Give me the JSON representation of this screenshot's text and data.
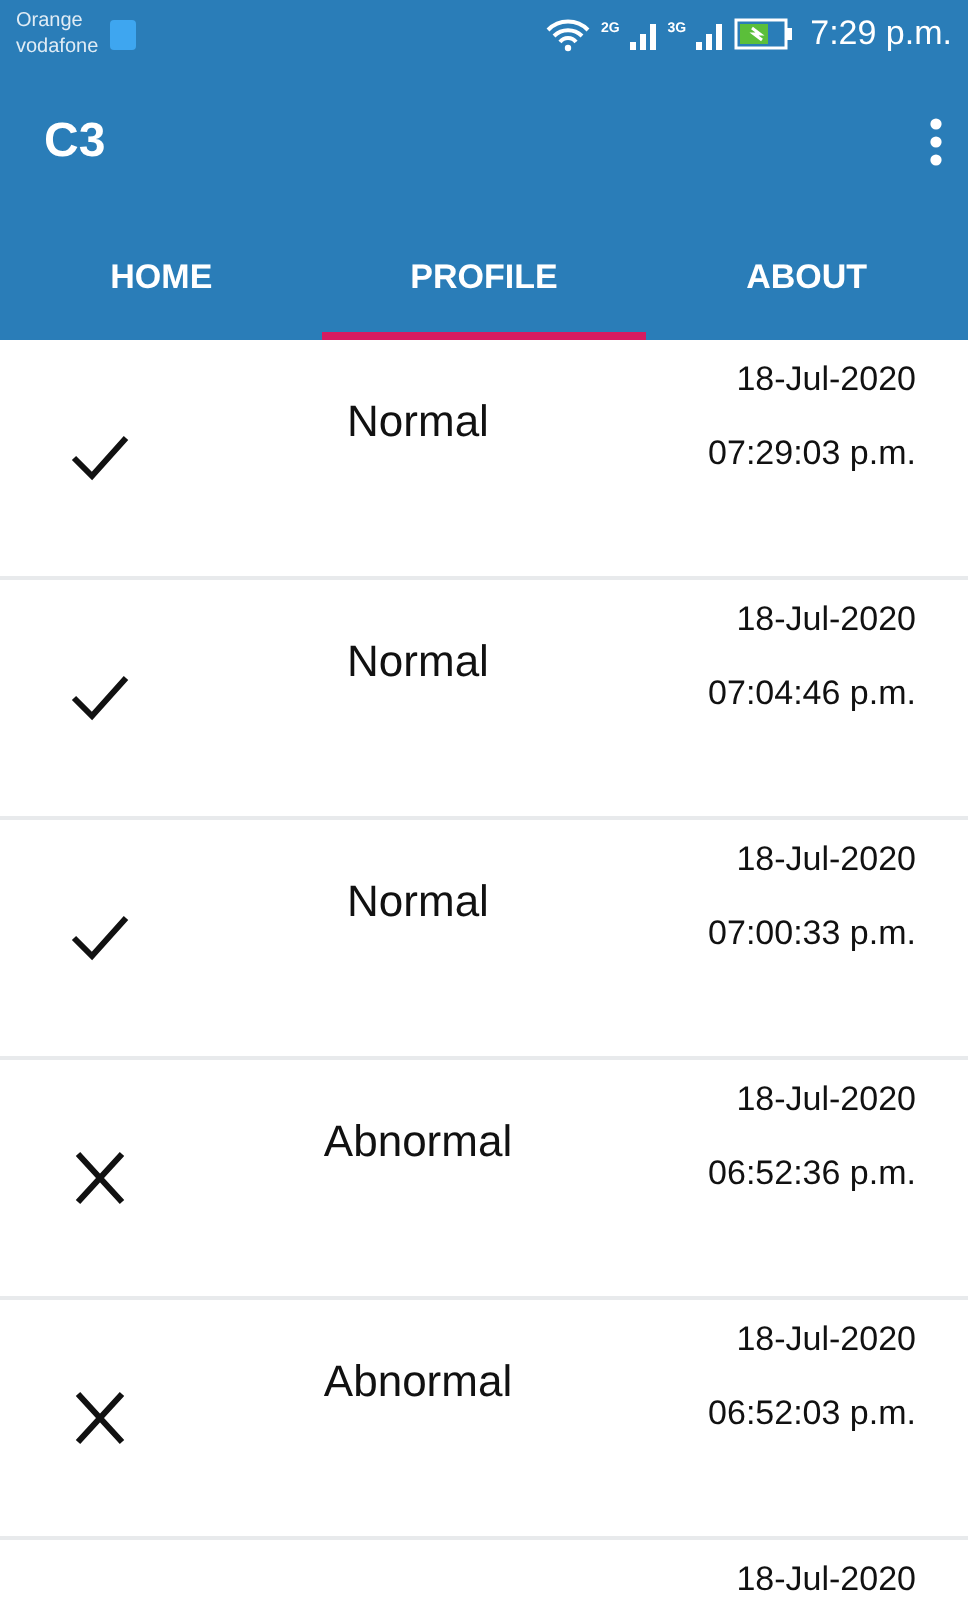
{
  "status_bar": {
    "carriers": [
      "Orange",
      "vodafone"
    ],
    "networks": [
      "2G",
      "3G"
    ],
    "time": "7:29 p.m."
  },
  "app_bar": {
    "title": "C3"
  },
  "tabs": [
    {
      "label": "HOME",
      "selected": false
    },
    {
      "label": "PROFILE",
      "selected": true
    },
    {
      "label": "ABOUT",
      "selected": false
    }
  ],
  "rows": [
    {
      "kind": "normal",
      "status": "Normal",
      "date": "18-Jul-2020",
      "time": "07:29:03 p.m."
    },
    {
      "kind": "normal",
      "status": "Normal",
      "date": "18-Jul-2020",
      "time": "07:04:46 p.m."
    },
    {
      "kind": "normal",
      "status": "Normal",
      "date": "18-Jul-2020",
      "time": "07:00:33 p.m."
    },
    {
      "kind": "abnormal",
      "status": "Abnormal",
      "date": "18-Jul-2020",
      "time": "06:52:36 p.m."
    },
    {
      "kind": "abnormal",
      "status": "Abnormal",
      "date": "18-Jul-2020",
      "time": "06:52:03 p.m."
    },
    {
      "kind": "partial",
      "date": "18-Jul-2020"
    }
  ]
}
